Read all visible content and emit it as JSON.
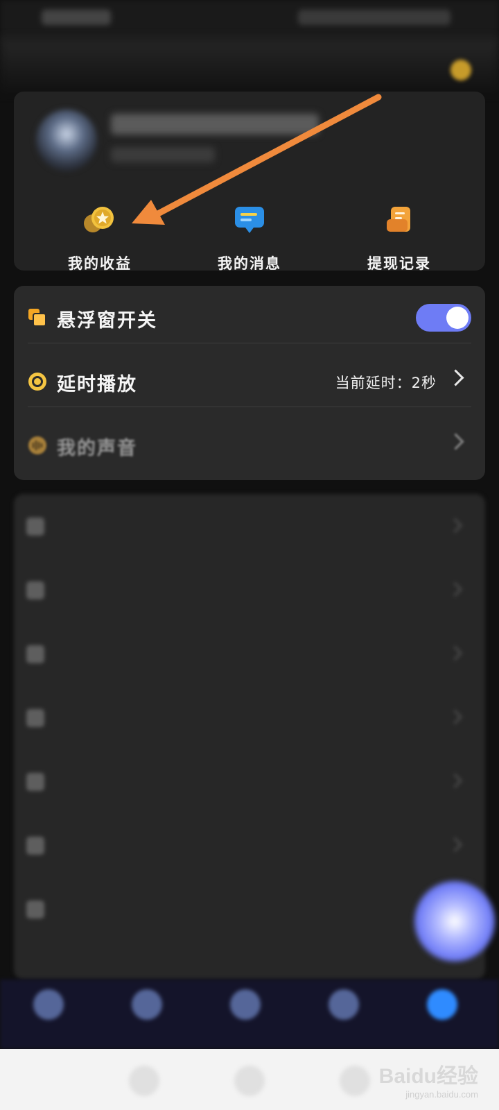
{
  "colors": {
    "accent_toggle": "#6e7cf5",
    "arrow": "#f08a3c",
    "card_bg": "#2a2a2a",
    "tab_active": "#2f8bff"
  },
  "profile": {
    "quick_actions": [
      {
        "label": "我的收益",
        "icon": "coin-star-icon"
      },
      {
        "label": "我的消息",
        "icon": "message-icon"
      },
      {
        "label": "提现记录",
        "icon": "record-icon"
      }
    ]
  },
  "settings": {
    "floating_window": {
      "label": "悬浮窗开关",
      "icon": "floating-window-icon",
      "toggle_on": true
    },
    "delay_play": {
      "label": "延时播放",
      "icon": "timer-icon",
      "value": "当前延时：2秒"
    },
    "my_voice": {
      "label": "我的声音",
      "icon": "voice-icon"
    }
  },
  "watermark": {
    "logo": "Baidu经验",
    "url": "jingyan.baidu.com"
  }
}
